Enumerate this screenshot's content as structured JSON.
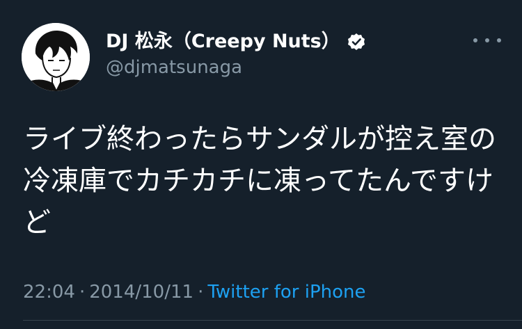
{
  "author": {
    "display_name": "DJ 松永（Creepy Nuts）",
    "handle": "@djmatsunaga",
    "verified": true,
    "avatar_icon": "avatar-illustration"
  },
  "tweet": {
    "text": "ライブ終わったらサンダルが控え室の冷凍庫でカチカチに凍ってたんですけど",
    "time": "22:04",
    "separator": "·",
    "date": "2014/10/11",
    "source": "Twitter for iPhone"
  },
  "icons": {
    "verified": "verified-badge-icon",
    "more": "more-options-icon"
  },
  "colors": {
    "background": "#15202b",
    "text_primary": "#ffffff",
    "text_secondary": "#8899a6",
    "link": "#1da1f2"
  }
}
